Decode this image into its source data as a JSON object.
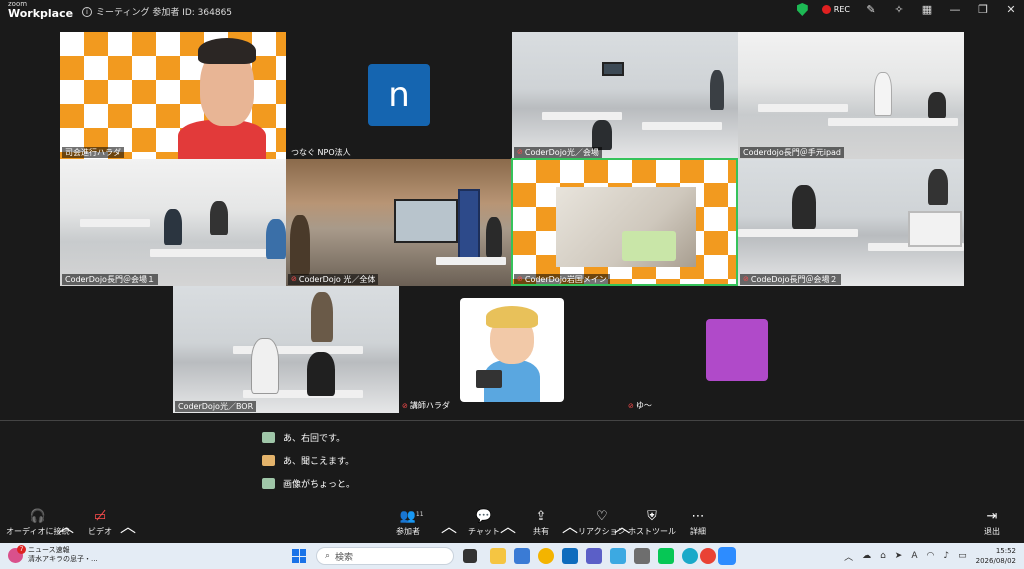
{
  "window": {
    "logo_line1": "zoom",
    "logo_line2": "Workplace",
    "meeting_info": "ミーティング 参加者 ID: 364865",
    "rec_label": "REC"
  },
  "tiles": [
    {
      "id": "host",
      "label": "司会進行ハラダ"
    },
    {
      "id": "npo",
      "label": "つなぐ NPO法人",
      "avatar_letter": "n"
    },
    {
      "id": "hikari-venue",
      "label": "CoderDojo光／会場",
      "muted": true
    },
    {
      "id": "nagato-ipad",
      "label": "Coderdojo長門＠手元ipad"
    },
    {
      "id": "nagato-venue1",
      "label": "CoderDojo長門＠会場１"
    },
    {
      "id": "hikari-all",
      "label": "CoderDojo 光／全体",
      "muted": true
    },
    {
      "id": "iwakuni-main",
      "label": "CoderDojo岩国メイン",
      "muted": true,
      "active": true
    },
    {
      "id": "nagato-venue2",
      "label": "CodeDojo長門＠会場２",
      "muted": true
    },
    {
      "id": "hikari-bor",
      "label": "CoderDojo光／BOR"
    },
    {
      "id": "instructor",
      "label": "講師ハラダ",
      "muted": true
    },
    {
      "id": "yu",
      "label": "ゆ〜",
      "muted": true
    }
  ],
  "chat": {
    "messages": [
      {
        "text": "あ、右回です。"
      },
      {
        "text": "あ、聞こえます。"
      },
      {
        "text": "画像がちょっと。"
      }
    ]
  },
  "toolbar": {
    "audio": "オーディオに接続",
    "video": "ビデオ",
    "participants": "参加者",
    "participants_count": "11",
    "chat": "チャット",
    "share": "共有",
    "reactions": "リアクション",
    "host_tools": "ホストツール",
    "more": "詳細",
    "leave": "退出"
  },
  "taskbar": {
    "news_title": "ニュース速報",
    "news_sub": "清水アキラの息子・...",
    "news_badge": "7",
    "search_placeholder": "検索",
    "time": "15:52",
    "date": "2026/08/02"
  },
  "colors": {
    "active_speaker": "#35c35b",
    "npo_avatar": "#1565b0",
    "yu_avatar": "#b04ac9",
    "muted": "#ff4d4d",
    "rec": "#e02020"
  }
}
